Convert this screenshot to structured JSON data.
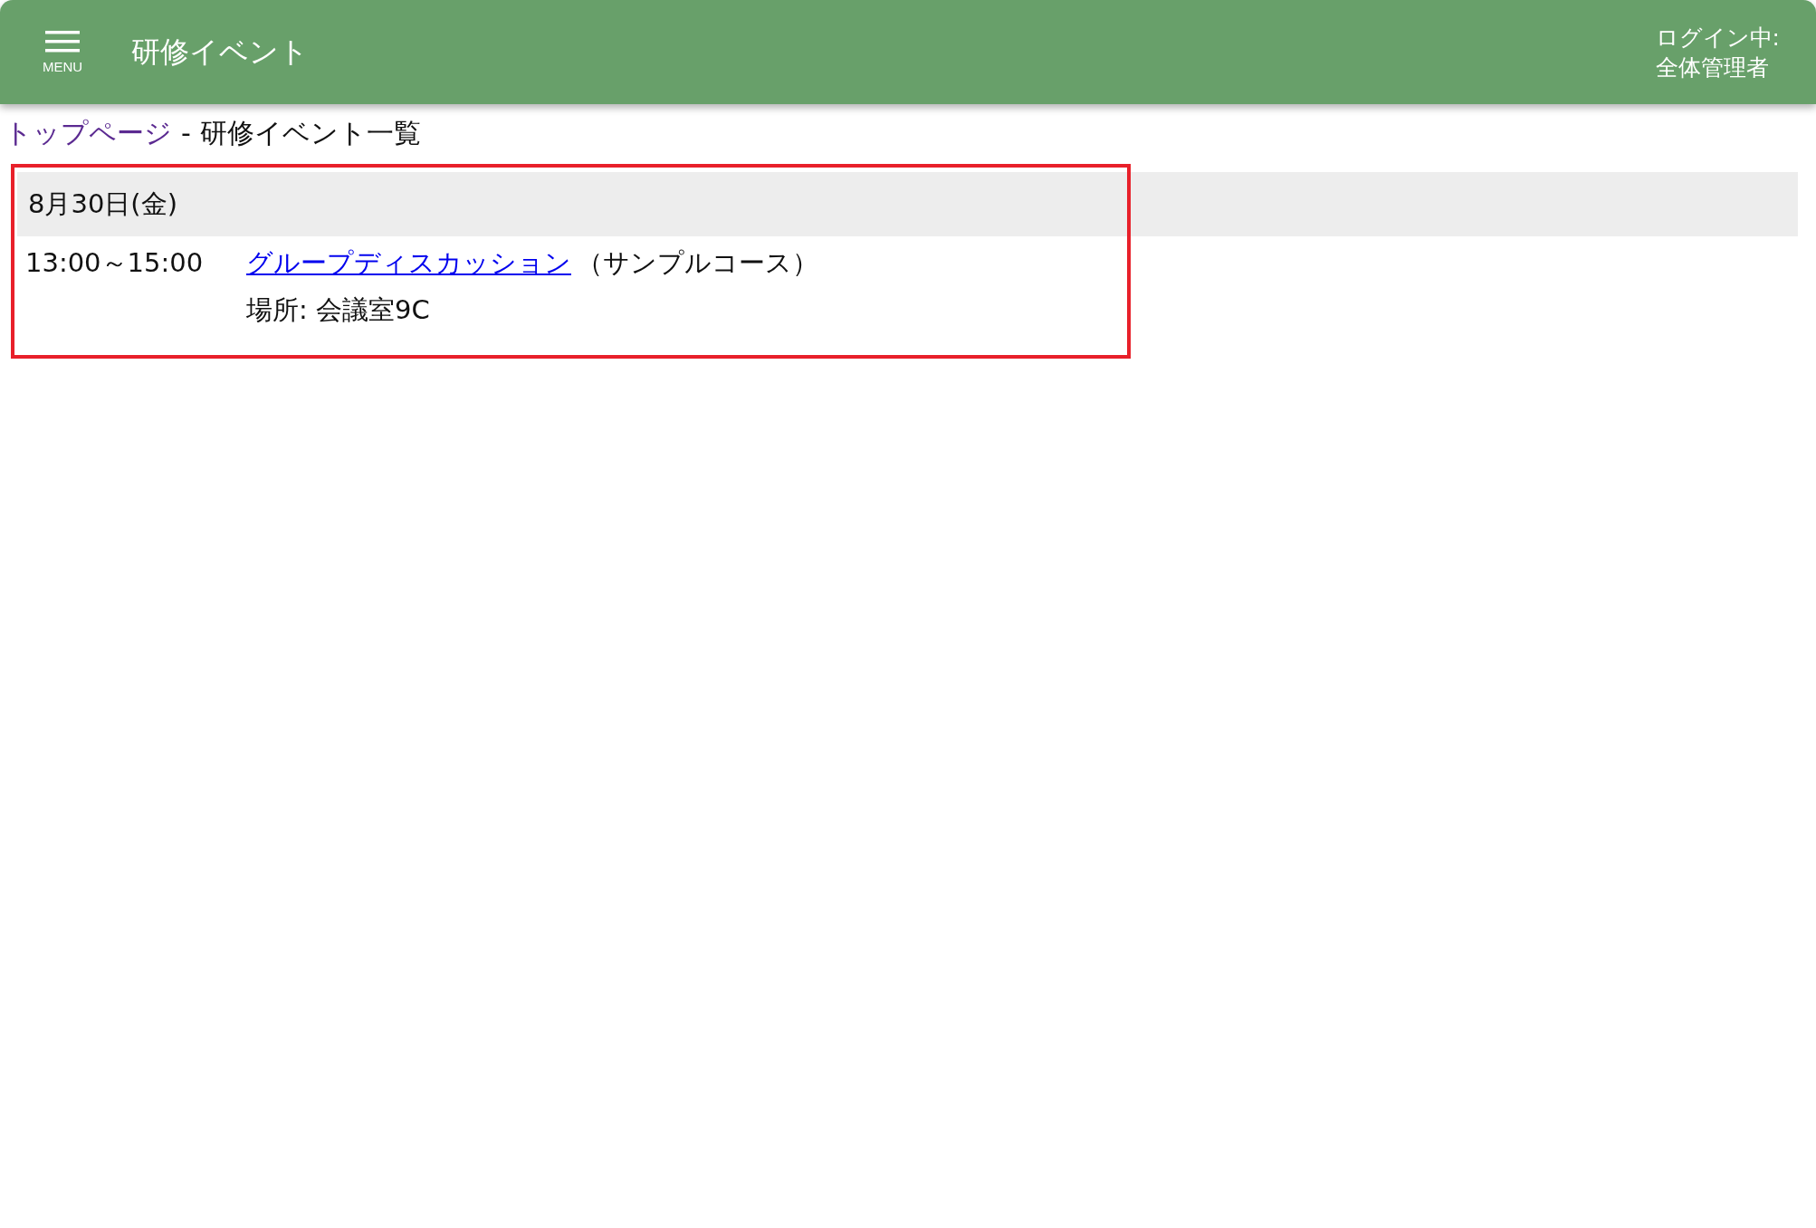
{
  "header": {
    "menu_label": "MENU",
    "title": "研修イベント",
    "login_label": "ログイン中:",
    "login_user": "全体管理者"
  },
  "breadcrumb": {
    "link": "トップページ",
    "separator": "-",
    "current": "研修イベント一覧"
  },
  "days": [
    {
      "date": "8月30日(金)",
      "events": [
        {
          "time": "13:00～15:00",
          "title": "グループディスカッション",
          "course": "（サンプルコース）",
          "location": "場所: 会議室9C"
        }
      ]
    }
  ]
}
